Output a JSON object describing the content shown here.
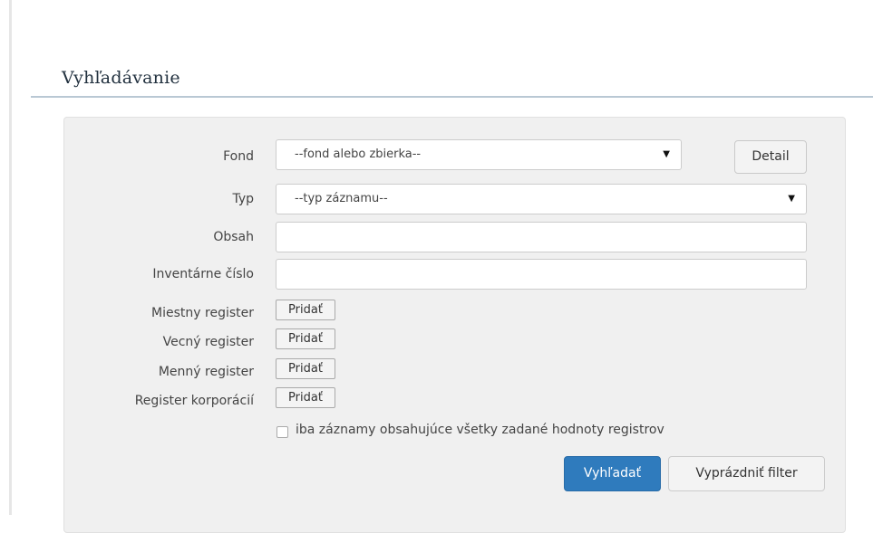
{
  "section": {
    "title": "Vyhľadávanie"
  },
  "form": {
    "fond": {
      "label": "Fond",
      "selected": "--fond alebo zbierka--",
      "detail_button": "Detail"
    },
    "typ": {
      "label": "Typ",
      "selected": "--typ záznamu--"
    },
    "obsah": {
      "label": "Obsah",
      "value": ""
    },
    "inventarne_cislo": {
      "label": "Inventárne číslo",
      "value": ""
    },
    "registers": [
      {
        "label": "Miestny register",
        "button": "Pridať"
      },
      {
        "label": "Vecný register",
        "button": "Pridať"
      },
      {
        "label": "Menný register",
        "button": "Pridať"
      },
      {
        "label": "Register korporácií",
        "button": "Pridať"
      }
    ],
    "only_all_registers": {
      "label": "iba záznamy obsahujúce všetky zadané hodnoty registrov",
      "checked": false
    },
    "search_button": "Vyhľadať",
    "clear_button": "Vyprázdniť filter"
  },
  "colors": {
    "primary": "#2f7bbd",
    "panel": "#f0f0f0",
    "heading_rule": "#b9c8d4"
  }
}
